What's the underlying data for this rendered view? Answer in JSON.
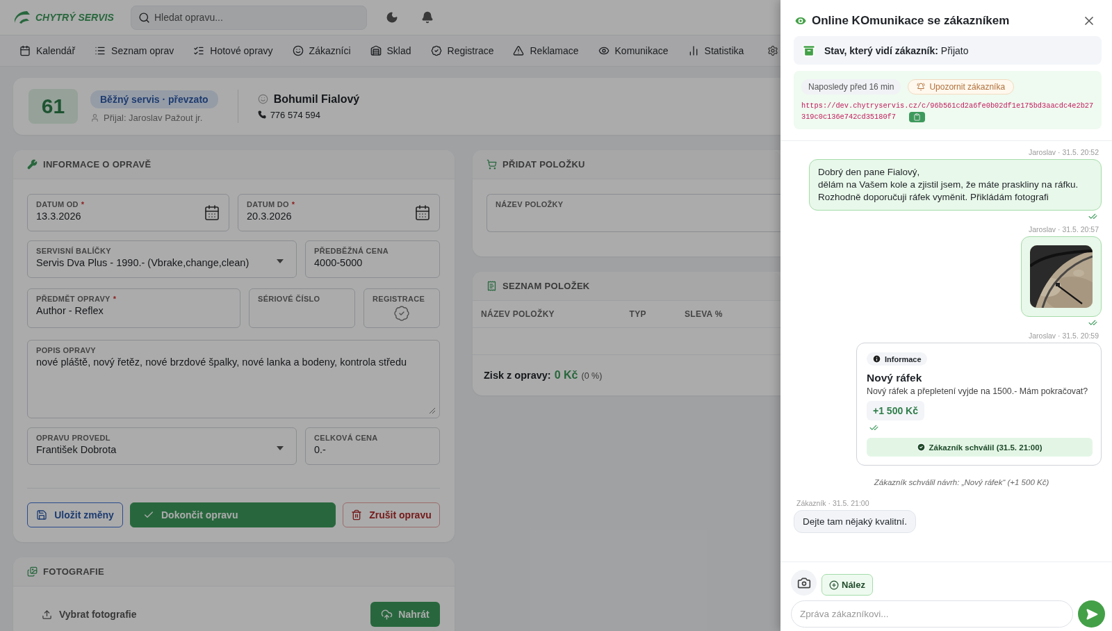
{
  "app": {
    "logo": "CHYTRÝ SERVIS",
    "search": {
      "placeholder": "Hledat opravu..."
    },
    "nav": [
      {
        "label": "Kalendář"
      },
      {
        "label": "Seznam oprav"
      },
      {
        "label": "Hotové opravy"
      },
      {
        "label": "Zákazníci"
      },
      {
        "label": "Sklad"
      },
      {
        "label": "Registrace"
      },
      {
        "label": "Reklamace"
      },
      {
        "label": "Komunikace"
      },
      {
        "label": "Statistika"
      }
    ],
    "order": {
      "number": "61",
      "status": "Běžný servis · převzato",
      "received_by": "Přijal: Jaroslav Pažout jr.",
      "customer": "Bohumil Fialový",
      "phone": "776 574 594"
    },
    "repair_info": {
      "title": "INFORMACE O OPRAVĚ",
      "rows": [
        [
          {
            "kind": "date",
            "label": "DATUM OD",
            "required_mark": "*",
            "value": "13.3.2026"
          },
          {
            "kind": "date",
            "label": "DATUM DO",
            "required_mark": "*",
            "value": "20.3.2026"
          }
        ],
        [
          {
            "kind": "select",
            "label": "SERVISNÍ BALÍČKY",
            "value": "Servis Dva Plus - 1990.- (Vbrake,change,clean)"
          },
          {
            "kind": "text",
            "label": "PŘEDBĚŽNÁ CENA",
            "value": "4000-5000"
          }
        ],
        [
          {
            "kind": "text",
            "label": "PŘEDMĚT OPRAVY",
            "required_mark": "*",
            "value": "Author - Reflex"
          },
          {
            "kind": "text",
            "label": "SÉRIOVÉ ČÍSLO"
          },
          {
            "kind": "badge",
            "label": "REGISTRACE"
          }
        ],
        [
          {
            "kind": "textarea",
            "label": "POPIS OPRAVY",
            "value": "nové pláště, nový řetěz, nové brzdové špalky, nové lanka a bodeny, kontrola středu"
          }
        ],
        [
          {
            "kind": "select",
            "label": "OPRAVU PROVEDL",
            "value": "František Dobrota"
          },
          {
            "kind": "text",
            "label": "CELKOVÁ CENA",
            "value": "0.-"
          }
        ]
      ],
      "buttons": [
        {
          "kind": "outline-primary",
          "label": "Uložit změny"
        },
        {
          "kind": "success",
          "label": "Dokončit opravu"
        },
        {
          "kind": "outline-danger",
          "label": "Zrušit opravu"
        }
      ]
    },
    "photos": {
      "title": "FOTOGRAFIE",
      "choose": "Vybrat fotografie",
      "upload": "Nahrát"
    },
    "add_item": {
      "title": "PŘIDAT POLOŽKU",
      "field_label": "NÁZEV POLOŽKY"
    },
    "items": {
      "title": "SEZNAM POLOŽEK",
      "columns": [
        "NÁZEV POLOŽKY",
        "TYP",
        "SLEVA %"
      ],
      "profit_label": "Zisk z opravy:",
      "profit_value": "0 Kč",
      "profit_percent": "(0 %)"
    }
  },
  "drawer": {
    "title": "Online KOmunikace se zákazníkem",
    "status_label": "Stav, který vidí zákazník:",
    "status_value": "Přijato",
    "last_seen": "Naposledy před 16 min",
    "notify": "Upozornit zákazníka",
    "link": "https://dev.chytryservis.cz/c/96b561cd2a6fe0b02df1e175bd3aacdc4e2b27319c0c136e742cd35180f7",
    "messages": [
      {
        "kind": "outgoing",
        "meta": "Jaroslav · 31.5. 20:52",
        "text": "Dobrý den pane Fialový,\ndělám na Vašem kole a zjistil jsem, že máte praskliny na ráfku.\nRozhodně doporučuji ráfek vyměnit. Přikládám fotografi",
        "read": true
      },
      {
        "meta": "Jaroslav · 31.5. 20:57",
        "read": true
      },
      {
        "kind": "proposal",
        "meta": "Jaroslav · 31.5. 20:59",
        "tag": "Informace",
        "title": "Nový ráfek",
        "text": "Nový ráfek a přepletení vyjde na 1500.- Mám pokračovat?",
        "price": "+1 500 Kč",
        "read": true,
        "approval": "Zákazník schválil (31.5. 21:00)"
      },
      {
        "kind": "system",
        "text": "Zákazník schválil návrh: „Nový ráfek“ (+1 500 Kč)"
      },
      {
        "kind": "incoming",
        "meta": "Zákazník · 31.5. 21:00",
        "text": "Dejte tam nějaký kvalitní."
      }
    ],
    "finding_button": "Nález",
    "composer": {
      "placeholder": "Zpráva zákazníkovi..."
    }
  }
}
